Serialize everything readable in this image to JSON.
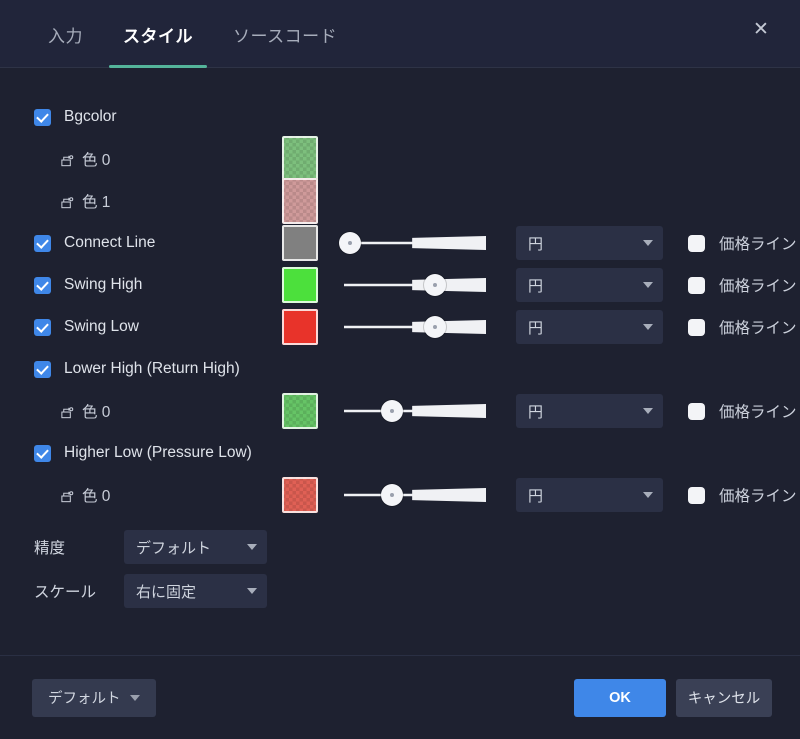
{
  "tabs": [
    {
      "label": "入力",
      "active": false
    },
    {
      "label": "スタイル",
      "active": true
    },
    {
      "label": "ソースコード",
      "active": false
    }
  ],
  "close_icon": "close-icon",
  "accent_color": "#54b49a",
  "checkbox_color": "#3f87e8",
  "rows": [
    {
      "name": "bgcolor",
      "label": "Bgcolor",
      "checked": true,
      "indent": false,
      "has_swatch": false,
      "has_slider": false,
      "has_select": false,
      "has_priceline": false
    },
    {
      "name": "bgcolor-color-0",
      "label": "色 0",
      "indent": true,
      "checked": null,
      "has_swatch": true,
      "swatch_color": "#7dbf7d",
      "swatch_checker": true,
      "swatch_tall": true,
      "has_slider": false,
      "has_select": false,
      "has_priceline": false
    },
    {
      "name": "bgcolor-color-1",
      "label": "色 1",
      "indent": true,
      "checked": null,
      "has_swatch": true,
      "swatch_color": "#cf9a9a",
      "swatch_checker": true,
      "swatch_tall": true,
      "has_slider": false,
      "has_select": false,
      "has_priceline": false
    },
    {
      "name": "connect-line",
      "label": "Connect Line",
      "checked": true,
      "indent": false,
      "has_swatch": true,
      "swatch_color": "#808080",
      "swatch_checker": false,
      "has_slider": true,
      "slider_value": 4,
      "has_select": true,
      "select_value": "円",
      "has_priceline": true,
      "priceline_checked": false,
      "priceline_label": "価格ライン"
    },
    {
      "name": "swing-high",
      "label": "Swing High",
      "checked": true,
      "indent": false,
      "has_swatch": true,
      "swatch_color": "#4ce03c",
      "swatch_checker": false,
      "has_slider": true,
      "slider_value": 64,
      "has_select": true,
      "select_value": "円",
      "has_priceline": true,
      "priceline_checked": false,
      "priceline_label": "価格ライン"
    },
    {
      "name": "swing-low",
      "label": "Swing Low",
      "checked": true,
      "indent": false,
      "has_swatch": true,
      "swatch_color": "#e8332a",
      "swatch_checker": false,
      "has_slider": true,
      "slider_value": 64,
      "has_select": true,
      "select_value": "円",
      "has_priceline": true,
      "priceline_checked": false,
      "priceline_label": "価格ライン"
    },
    {
      "name": "lower-high-return-high",
      "label": "Lower High (Return High)",
      "checked": true,
      "indent": false,
      "has_swatch": false,
      "has_slider": false,
      "has_select": false,
      "has_priceline": false
    },
    {
      "name": "lower-high-color-0",
      "label": "色 0",
      "indent": true,
      "checked": null,
      "has_swatch": true,
      "swatch_color": "#66c466",
      "swatch_checker": true,
      "has_slider": true,
      "slider_value": 34,
      "has_select": true,
      "select_value": "円",
      "has_priceline": true,
      "priceline_checked": false,
      "priceline_label": "価格ライン"
    },
    {
      "name": "higher-low-pressure-low",
      "label": "Higher Low (Pressure Low)",
      "checked": true,
      "indent": false,
      "has_swatch": false,
      "has_slider": false,
      "has_select": false,
      "has_priceline": false
    },
    {
      "name": "higher-low-color-0",
      "label": "色 0",
      "indent": true,
      "checked": null,
      "has_swatch": true,
      "swatch_color": "#e06055",
      "swatch_checker": true,
      "has_slider": true,
      "slider_value": 34,
      "has_select": true,
      "select_value": "円",
      "has_priceline": true,
      "priceline_checked": false,
      "priceline_label": "価格ライン"
    }
  ],
  "bottom_settings": [
    {
      "name": "precision",
      "label": "精度",
      "value": "デフォルト"
    },
    {
      "name": "scale",
      "label": "スケール",
      "value": "右に固定"
    }
  ],
  "footer": {
    "defaults_label": "デフォルト",
    "ok_label": "OK",
    "cancel_label": "キャンセル"
  }
}
